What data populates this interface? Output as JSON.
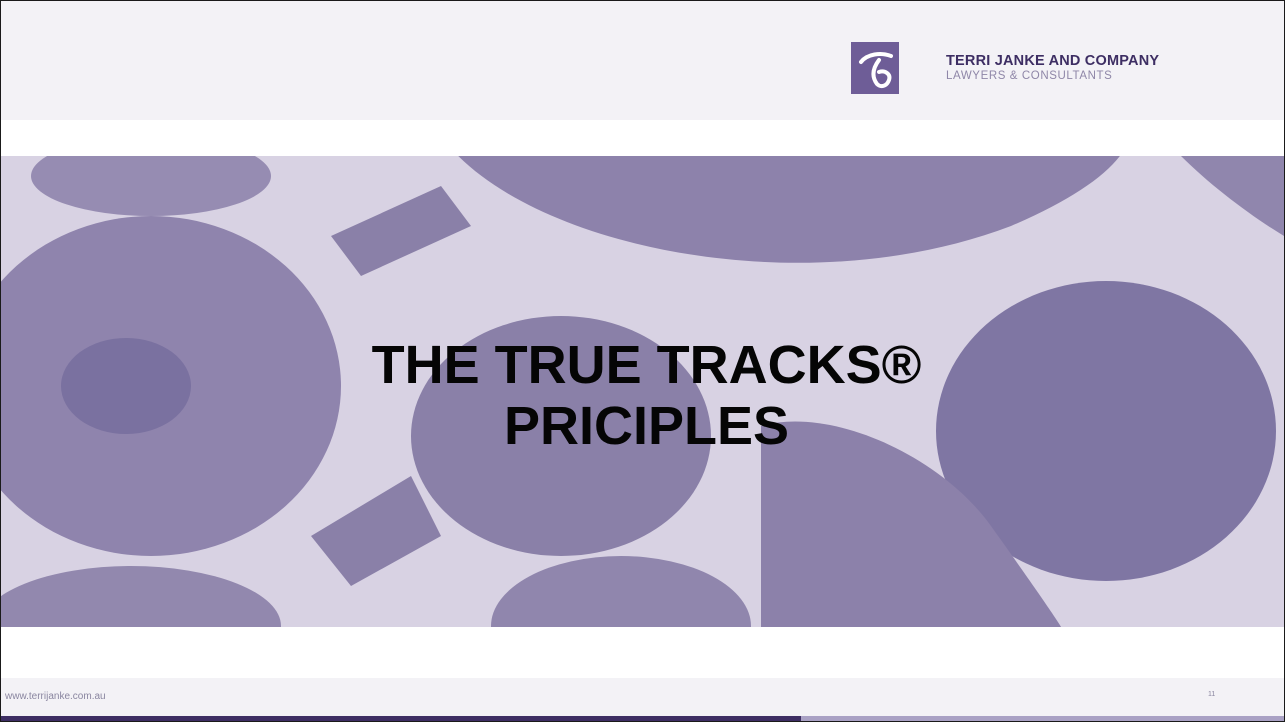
{
  "header": {
    "company_name": "TERRI JANKE AND COMPANY",
    "company_tagline": "LAWYERS & CONSULTANTS",
    "logo_color": "#6e5d97"
  },
  "slide": {
    "title_line_1": "THE TRUE TRACKS®",
    "title_line_2": "PRICIPLES"
  },
  "footer": {
    "url": "www.terrijanke.com.au",
    "page_number": "11"
  },
  "colors": {
    "brand_dark": "#3d2e63",
    "banner_purple": "#8b80a9",
    "banner_light": "#d6d0e1"
  }
}
